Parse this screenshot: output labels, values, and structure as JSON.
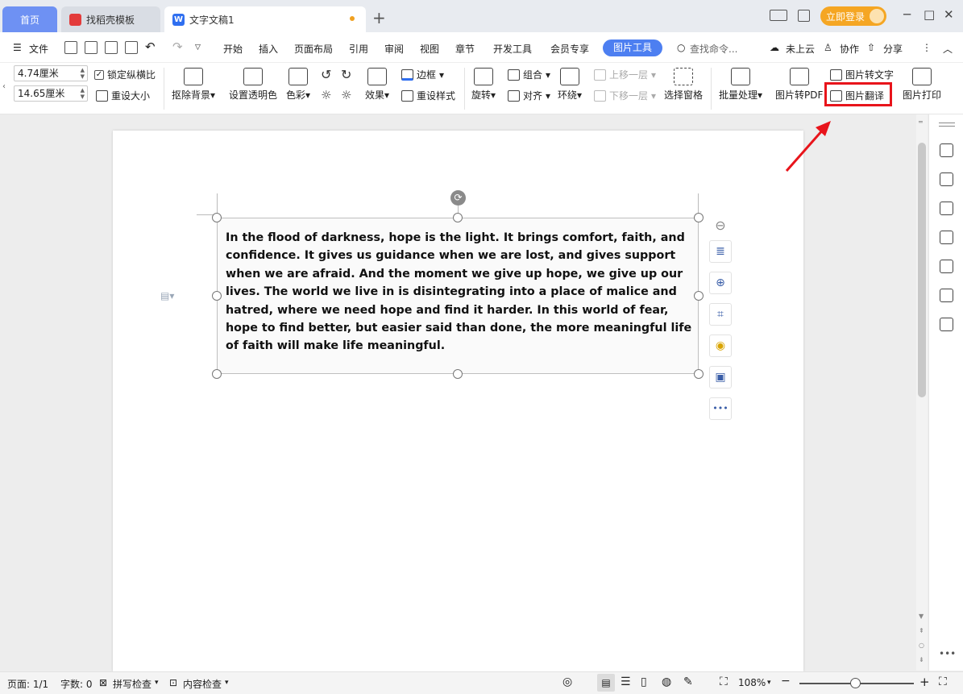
{
  "tabs": {
    "home": "首页",
    "template": "找稻壳模板",
    "document": "文字文稿1",
    "new_tab": "+"
  },
  "window": {
    "login": "立即登录",
    "minimize": "─",
    "maximize": "□",
    "close": "✕"
  },
  "menu": {
    "file": "文件",
    "items": [
      "开始",
      "插入",
      "页面布局",
      "引用",
      "审阅",
      "视图",
      "章节",
      "开发工具",
      "会员专享"
    ],
    "active": "图片工具",
    "search": "查找命令...",
    "cloud": "未上云",
    "collab": "协作",
    "share": "分享",
    "more": "⋮",
    "collapse": "︿"
  },
  "ribbon": {
    "height_value": "4.74厘米",
    "width_value": "14.65厘米",
    "lock_ratio": "锁定纵横比",
    "reset_size": "重设大小",
    "remove_bg": "抠除背景",
    "set_transparent": "设置透明色",
    "color": "色彩",
    "effects": "效果",
    "border": "边框",
    "reset_style": "重设样式",
    "rotate": "旋转",
    "group": "组合",
    "align": "对齐",
    "wrap": "环绕",
    "bring_forward": "上移一层",
    "send_backward": "下移一层",
    "selection_pane": "选择窗格",
    "batch": "批量处理",
    "to_pdf": "图片转PDF",
    "to_text": "图片转文字",
    "translate": "图片翻译",
    "print": "图片打印"
  },
  "document": {
    "body": "In the flood of darkness, hope is the light. It brings comfort, faith, and confidence. It gives us guidance when we are lost, and gives support when we are afraid. And the moment we give up hope, we give up our lives. The world we live in is disintegrating into a place of malice and hatred, where we need hope and find it harder. In this world of fear, hope to find better, but easier said than done, the more meaningful life of faith will make life meaningful."
  },
  "status": {
    "page": "页面: 1/1",
    "words": "字数: 0",
    "spell": "拼写检查",
    "content_check": "内容检查",
    "zoom": "108%",
    "zoom_out": "−",
    "zoom_in": "+"
  },
  "colors": {
    "accent": "#4d7ff1",
    "login": "#f5a623",
    "highlight": "#e8141b"
  }
}
